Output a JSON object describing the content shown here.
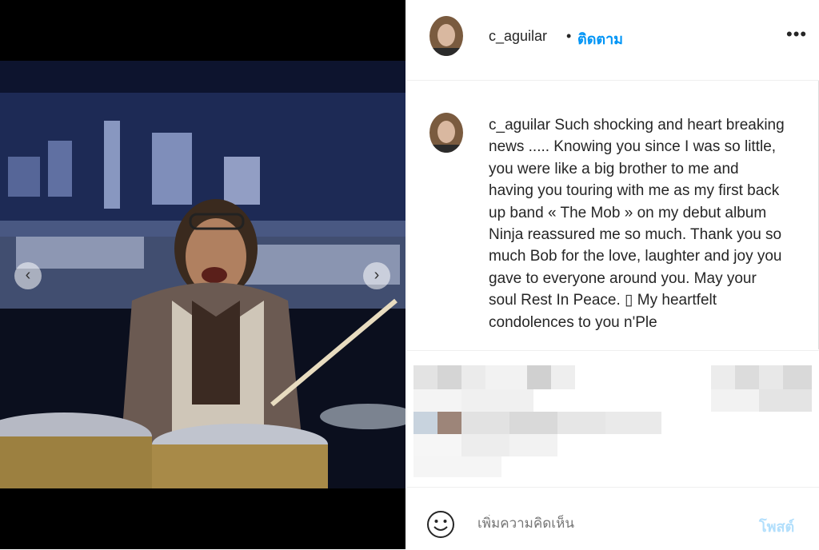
{
  "header": {
    "username": "c_aguilar",
    "dot": "•",
    "follow_label": "ติดตาม",
    "more_icon": "more-horizontal-icon"
  },
  "caption": {
    "username": "c_aguilar",
    "text": "Such shocking and heart breaking news ..... Knowing you since I was so little, you were like a big brother to me and having you touring with me as my first back up band « The Mob » on my debut album Ninja reassured me so much. Thank you so much Bob for the love, laughter and joy you gave to everyone around you. May your soul Rest In Peace. ▯ My heartfelt condolences to you n'Ple"
  },
  "media": {
    "prev_icon": "‹",
    "next_icon": "›"
  },
  "footer": {
    "comment_placeholder": "เพิ่มความคิดเห็น",
    "post_label": "โพสต์"
  },
  "colors": {
    "accent": "#0095f6",
    "post_disabled": "#b2dffc"
  }
}
